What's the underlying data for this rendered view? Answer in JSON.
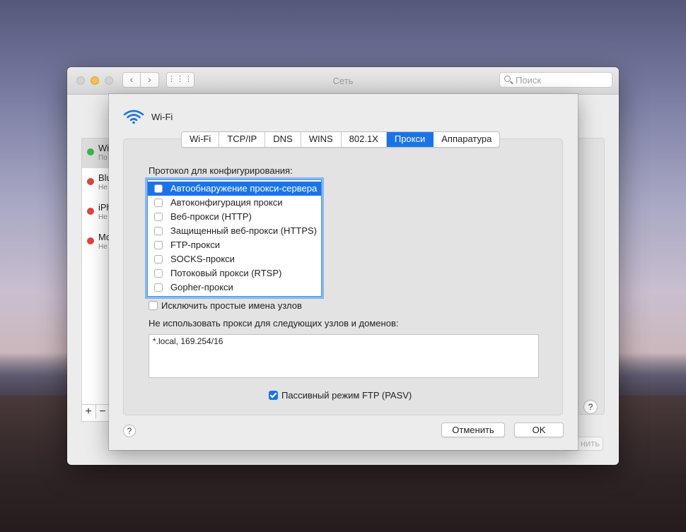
{
  "window": {
    "title": "Сеть",
    "search_placeholder": "Поиск",
    "nav_back": "‹",
    "nav_forward": "›",
    "grid_label": "⋮⋮⋮"
  },
  "services": [
    {
      "name": "Wi",
      "sub": "По",
      "status": "green",
      "color": "#3cb44a"
    },
    {
      "name": "Blu",
      "sub": "Не",
      "status": "red",
      "color": "#e0443e"
    },
    {
      "name": "iPh",
      "sub": "Не",
      "status": "red",
      "color": "#e0443e"
    },
    {
      "name": "Mo",
      "sub": "Не",
      "status": "red",
      "color": "#e0443e"
    }
  ],
  "sidebar_tools": {
    "add": "+",
    "remove": "−"
  },
  "background_apply_label": "нить",
  "sheet": {
    "interface": "Wi-Fi",
    "tabs": [
      "Wi-Fi",
      "TCP/IP",
      "DNS",
      "WINS",
      "802.1X",
      "Прокси",
      "Аппаратура"
    ],
    "active_tab": "Прокси",
    "protocol_label": "Протокол для конфигурирования:",
    "protocols": [
      {
        "label": "Автообнаружение прокси-сервера",
        "checked": false,
        "selected": true
      },
      {
        "label": "Автоконфигурация прокси",
        "checked": false,
        "selected": false
      },
      {
        "label": "Веб-прокси (HTTP)",
        "checked": false,
        "selected": false
      },
      {
        "label": "Защищенный веб-прокси (HTTPS)",
        "checked": false,
        "selected": false
      },
      {
        "label": "FTP-прокси",
        "checked": false,
        "selected": false
      },
      {
        "label": "SOCKS-прокси",
        "checked": false,
        "selected": false
      },
      {
        "label": "Потоковый прокси (RTSP)",
        "checked": false,
        "selected": false
      },
      {
        "label": "Gopher-прокси",
        "checked": false,
        "selected": false
      }
    ],
    "exclude_simple_label": "Исключить простые имена узлов",
    "exclude_simple_checked": false,
    "bypass_label": "Не использовать прокси для следующих узлов и доменов:",
    "bypass_value": "*.local, 169.254/16",
    "pasv_label": "Пассивный режим FTP (PASV)",
    "pasv_checked": true,
    "help": "?",
    "cancel_label": "Отменить",
    "ok_label": "OK"
  },
  "colors": {
    "accent": "#1a74e8",
    "status_green": "#3cb44a",
    "status_red": "#e0443e"
  }
}
